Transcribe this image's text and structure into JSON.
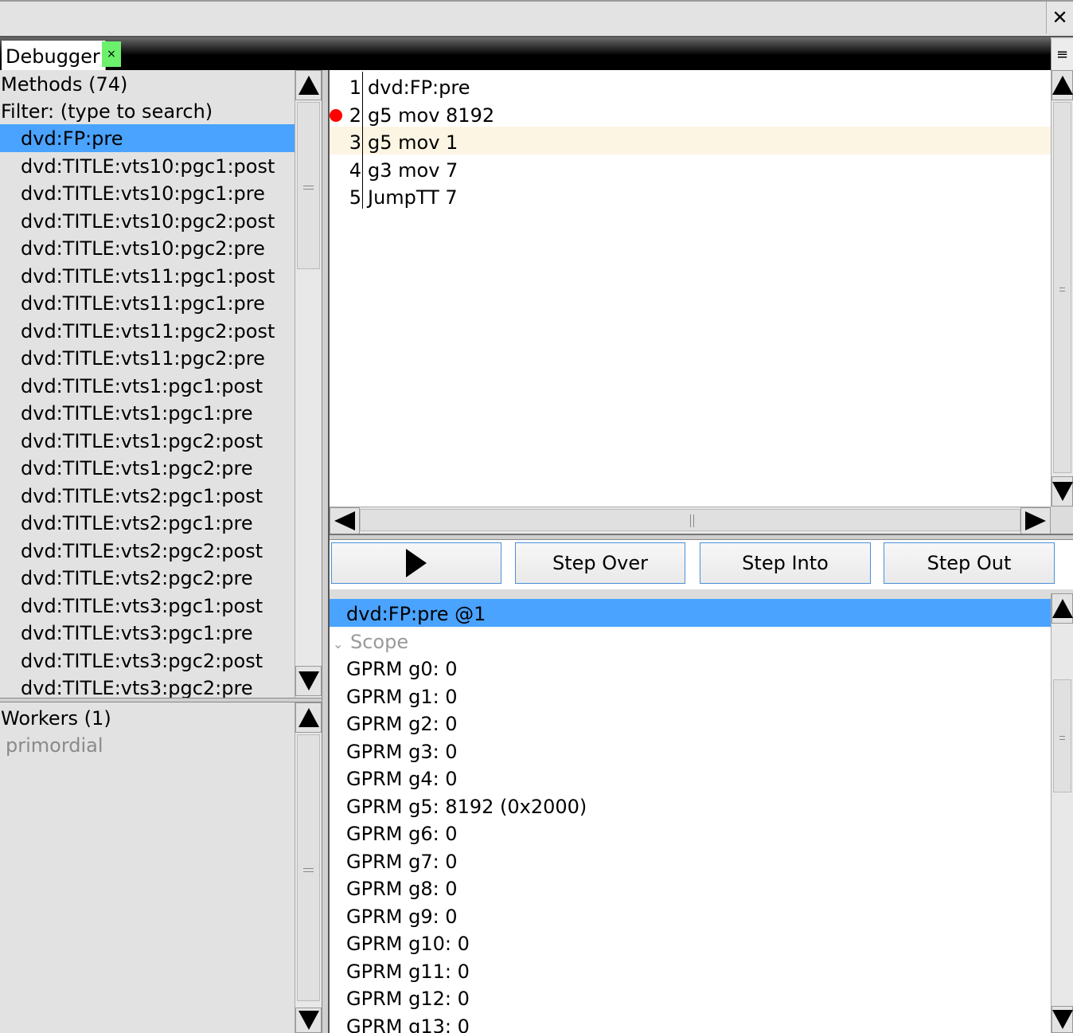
{
  "window": {
    "close_glyph": "✕"
  },
  "tabs": {
    "active_label": "Debugger",
    "close_glyph": "×",
    "menu_glyph": "≡"
  },
  "methods": {
    "header": "Methods (74)",
    "filter": "Filter: (type to search)",
    "items": [
      "dvd:FP:pre",
      "dvd:TITLE:vts10:pgc1:post",
      "dvd:TITLE:vts10:pgc1:pre",
      "dvd:TITLE:vts10:pgc2:post",
      "dvd:TITLE:vts10:pgc2:pre",
      "dvd:TITLE:vts11:pgc1:post",
      "dvd:TITLE:vts11:pgc1:pre",
      "dvd:TITLE:vts11:pgc2:post",
      "dvd:TITLE:vts11:pgc2:pre",
      "dvd:TITLE:vts1:pgc1:post",
      "dvd:TITLE:vts1:pgc1:pre",
      "dvd:TITLE:vts1:pgc2:post",
      "dvd:TITLE:vts1:pgc2:pre",
      "dvd:TITLE:vts2:pgc1:post",
      "dvd:TITLE:vts2:pgc1:pre",
      "dvd:TITLE:vts2:pgc2:post",
      "dvd:TITLE:vts2:pgc2:pre",
      "dvd:TITLE:vts3:pgc1:post",
      "dvd:TITLE:vts3:pgc1:pre",
      "dvd:TITLE:vts3:pgc2:post",
      "dvd:TITLE:vts3:pgc2:pre"
    ],
    "selected_index": 0
  },
  "workers": {
    "header": "Workers (1)",
    "items": [
      "primordial"
    ]
  },
  "code": {
    "lines": [
      {
        "num": "1",
        "text": "dvd:FP:pre",
        "breakpoint": false,
        "current": false
      },
      {
        "num": "2",
        "text": "g5 mov 8192",
        "breakpoint": true,
        "current": false
      },
      {
        "num": "3",
        "text": "g5 mov 1",
        "breakpoint": false,
        "current": true
      },
      {
        "num": "4",
        "text": "g3 mov 7",
        "breakpoint": false,
        "current": false
      },
      {
        "num": "5",
        "text": "JumpTT 7",
        "breakpoint": false,
        "current": false
      }
    ]
  },
  "toolbar": {
    "step_over": "Step Over",
    "step_into": "Step Into",
    "step_out": "Step Out"
  },
  "stack": {
    "frame": "dvd:FP:pre @1",
    "scope_label": "Scope"
  },
  "variables": [
    "GPRM g0: 0",
    "GPRM g1: 0",
    "GPRM g2: 0",
    "GPRM g3: 0",
    "GPRM g4: 0",
    "GPRM g5: 8192 (0x2000)",
    "GPRM g6: 0",
    "GPRM g7: 0",
    "GPRM g8: 0",
    "GPRM g9: 0",
    "GPRM g10: 0",
    "GPRM g11: 0",
    "GPRM g12: 0",
    "GPRM g13: 0"
  ],
  "colors": {
    "selection": "#4aa3ff",
    "current_line": "#fdf5e4",
    "breakpoint": "#ff0000",
    "tab_close": "#6cf06c"
  }
}
